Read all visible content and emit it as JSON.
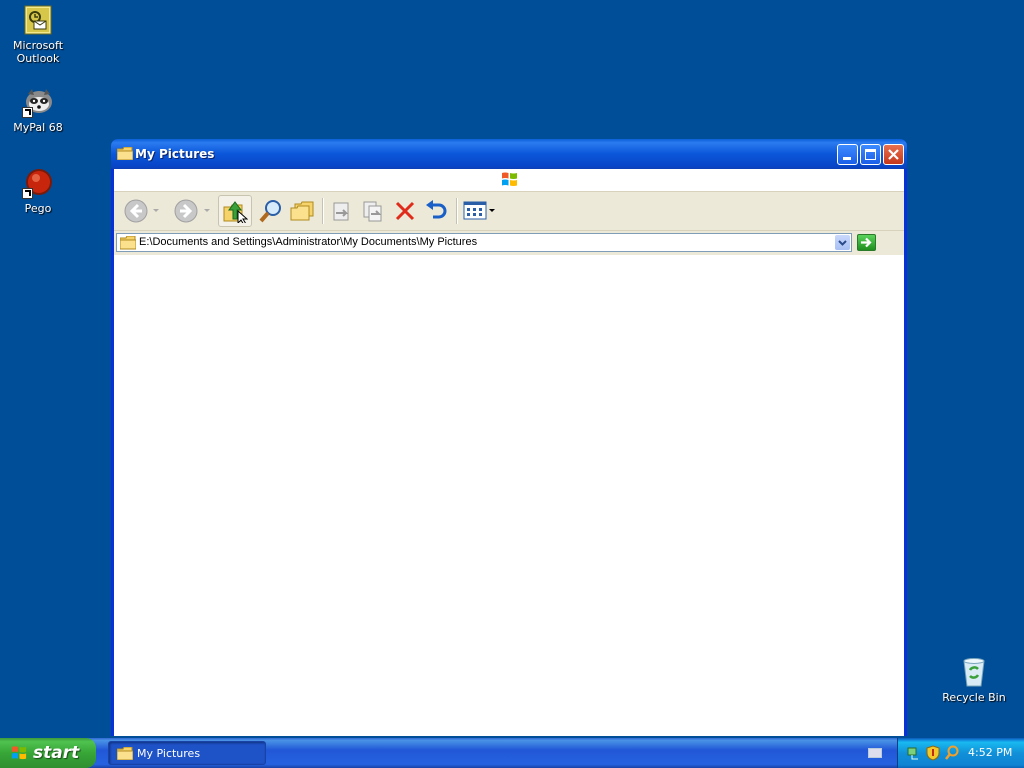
{
  "desktop": {
    "icons": [
      {
        "label_line1": "Microsoft",
        "label_line2": "Outlook",
        "icon": "outlook-icon"
      },
      {
        "label": "MyPal 68",
        "icon": "mypal-icon"
      },
      {
        "label": "Pego",
        "icon": "pego-icon"
      },
      {
        "label": "Recycle Bin",
        "icon": "recycle-bin-icon"
      }
    ],
    "background_color": "#004e98"
  },
  "window": {
    "title": "My Pictures",
    "address": "E:\\Documents and Settings\\Administrator\\My Documents\\My Pictures",
    "toolbar": [
      "back-icon",
      "forward-icon",
      "up-folder-icon",
      "search-icon",
      "folders-icon",
      "move-to-icon",
      "copy-to-icon",
      "delete-icon",
      "undo-icon",
      "views-icon"
    ]
  },
  "taskbar": {
    "start_label": "start",
    "task_items": [
      {
        "label": "My Pictures",
        "icon": "folder-icon"
      }
    ],
    "clock": "4:52 PM"
  }
}
